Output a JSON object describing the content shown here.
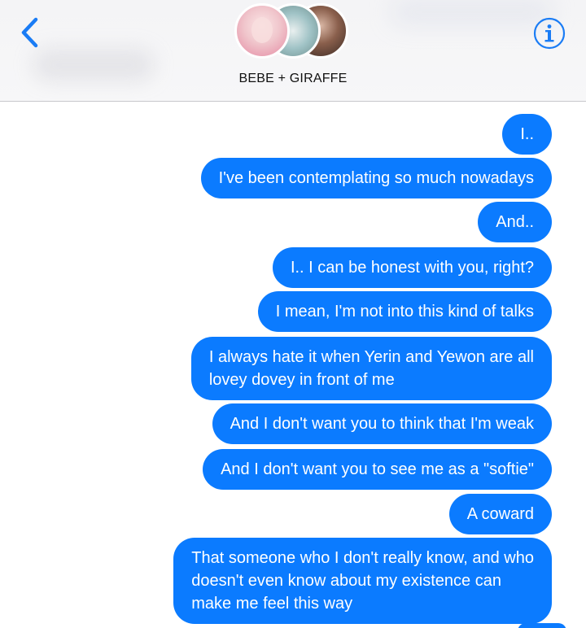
{
  "header": {
    "group_name": "BEBE + GIRAFFE",
    "back_icon": "chevron-left-icon",
    "info_icon": "info-circle-icon",
    "accent_color": "#1a7cf5"
  },
  "messages": [
    {
      "text": "I.."
    },
    {
      "text": "I've been contemplating so much nowadays"
    },
    {
      "text": "And.."
    },
    {
      "text": "I.. I can be honest with you, right?"
    },
    {
      "text": "I mean, I'm not into this kind of talks"
    },
    {
      "text": "I always hate it when Yerin and Yewon are all\nlovey dovey in front of me"
    },
    {
      "text": "And I don't want you to think that I'm weak"
    },
    {
      "text": "And I don't want you to see me as a \"softie\""
    },
    {
      "text": "A coward"
    },
    {
      "text": "That someone who I don't really know, and who\ndoesn't even know about my existence can\nmake me feel this way"
    }
  ],
  "colors": {
    "sent_bubble": "#0b7bff",
    "sent_text": "#ffffff"
  }
}
